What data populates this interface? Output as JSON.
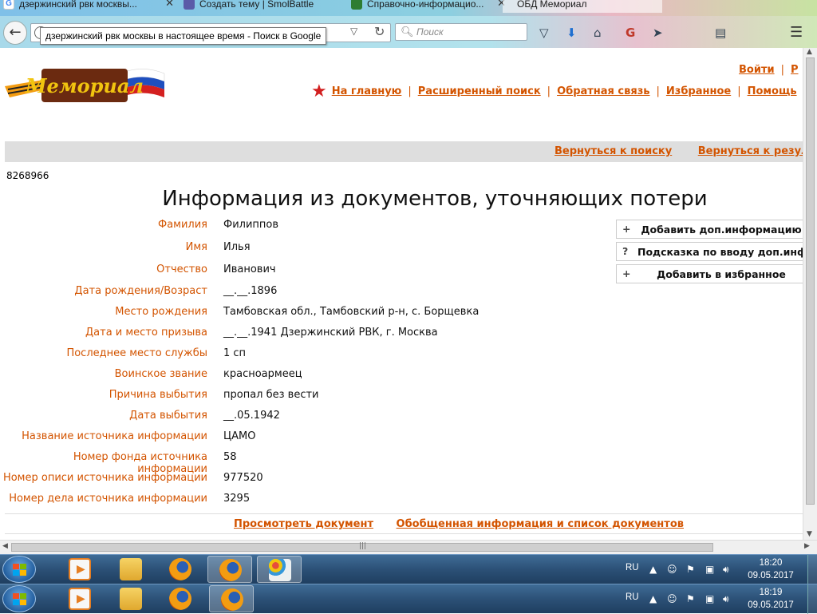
{
  "browser": {
    "tabs": [
      {
        "title": "дзержинский рвк москвы...",
        "active": false
      },
      {
        "title": "Создать тему | SmolBattle",
        "active": false
      },
      {
        "title": "Справочно-информацио...",
        "active": false
      },
      {
        "title": "ОБД Мемориал",
        "active": true
      }
    ],
    "url_value": "",
    "tooltip": "дзержинский рвк москвы в настоящее время - Поиск в Google",
    "search_placeholder": "Поиск"
  },
  "site": {
    "logo_text": "Мемориал",
    "login_link": "Войти",
    "register_link": "Р",
    "nav": [
      "На главную",
      "Расширенный поиск",
      "Обратная связь",
      "Избранное",
      "Помощь"
    ],
    "back_links": [
      "Вернуться к поиску",
      "Вернуться к результатам"
    ]
  },
  "record": {
    "id": "8268966",
    "title": "Информация из документов, уточняющих потери",
    "fields": [
      {
        "label": "Фамилия",
        "value": "Филиппов"
      },
      {
        "label": "Имя",
        "value": "Илья"
      },
      {
        "label": "Отчество",
        "value": "Иванович"
      },
      {
        "label": "Дата рождения/Возраст",
        "value": "__.__.1896"
      },
      {
        "label": "Место рождения",
        "value": "Тамбовская обл., Тамбовский р-н, с. Борщевка"
      },
      {
        "label": "Дата и место призыва",
        "value": "__.__.1941 Дзержинский РВК, г. Москва"
      },
      {
        "label": "Последнее место службы",
        "value": "1 сп"
      },
      {
        "label": "Воинское звание",
        "value": "красноармеец"
      },
      {
        "label": "Причина выбытия",
        "value": "пропал без вести"
      },
      {
        "label": "Дата выбытия",
        "value": "__.05.1942"
      },
      {
        "label": "Название источника информации",
        "value": "ЦАМО"
      },
      {
        "label": "Номер фонда источника информации",
        "value": "58"
      },
      {
        "label": "Номер описи источника информации",
        "value": "977520"
      },
      {
        "label": "Номер дела источника информации",
        "value": "3295"
      }
    ],
    "side_buttons": [
      {
        "symbol": "+",
        "label": "Добавить доп.информацию"
      },
      {
        "symbol": "?",
        "label": "Подсказка по вводу доп.информации"
      },
      {
        "symbol": "+",
        "label": "Добавить в избранное"
      }
    ],
    "bottom_links": [
      "Просмотреть документ",
      "Обобщенная информация и список документов"
    ]
  },
  "taskbars": [
    {
      "lang": "RU",
      "time": "18:20",
      "date": "09.05.2017"
    },
    {
      "lang": "RU",
      "time": "18:19",
      "date": "09.05.2017"
    }
  ],
  "colors": {
    "link": "#d35400",
    "label": "#d35400",
    "star": "#d21f1f"
  }
}
